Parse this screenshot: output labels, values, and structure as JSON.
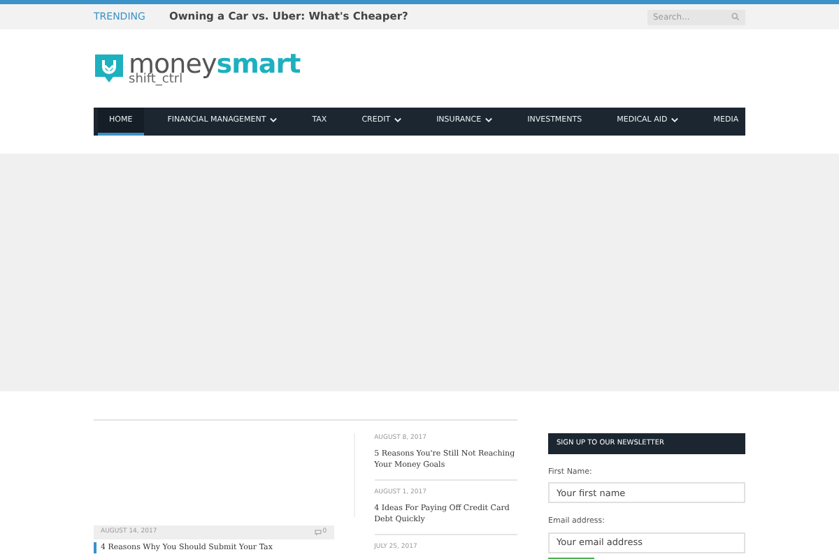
{
  "topbar": {
    "trending_label": "TRENDING",
    "trending_headline": "Owning a Car vs. Uber: What's Cheaper?",
    "search": {
      "placeholder": "Search..."
    }
  },
  "logo": {
    "brand_light": "money",
    "brand_bold": "smart",
    "tagline": "shift_ctrl"
  },
  "nav": [
    {
      "label": "HOME",
      "selected": true,
      "dropdown": false
    },
    {
      "label": "FINANCIAL MANAGEMENT",
      "selected": false,
      "dropdown": true
    },
    {
      "label": "TAX",
      "selected": false,
      "dropdown": false
    },
    {
      "label": "CREDIT",
      "selected": false,
      "dropdown": true
    },
    {
      "label": "INSURANCE",
      "selected": false,
      "dropdown": true
    },
    {
      "label": "INVESTMENTS",
      "selected": false,
      "dropdown": false
    },
    {
      "label": "MEDICAL AID",
      "selected": false,
      "dropdown": true
    },
    {
      "label": "MEDIA",
      "selected": false,
      "dropdown": false
    }
  ],
  "featured": {
    "date": "AUGUST 14, 2017",
    "comments": "0",
    "title": "4 Reasons Why You Should Submit Your Tax"
  },
  "posts": [
    {
      "date": "AUGUST 8, 2017",
      "title": "5 Reasons You're Still Not Reaching Your Money Goals"
    },
    {
      "date": "AUGUST 1, 2017",
      "title": "4 Ideas For Paying Off Credit Card Debt Quickly"
    },
    {
      "date": "JULY 25, 2017"
    }
  ],
  "newsletter": {
    "title": "SIGN UP TO OUR NEWSLETTER",
    "fields": [
      {
        "label": "First Name:",
        "placeholder": "Your first name"
      },
      {
        "label": "Email address:",
        "placeholder": "Your email address"
      }
    ]
  }
}
